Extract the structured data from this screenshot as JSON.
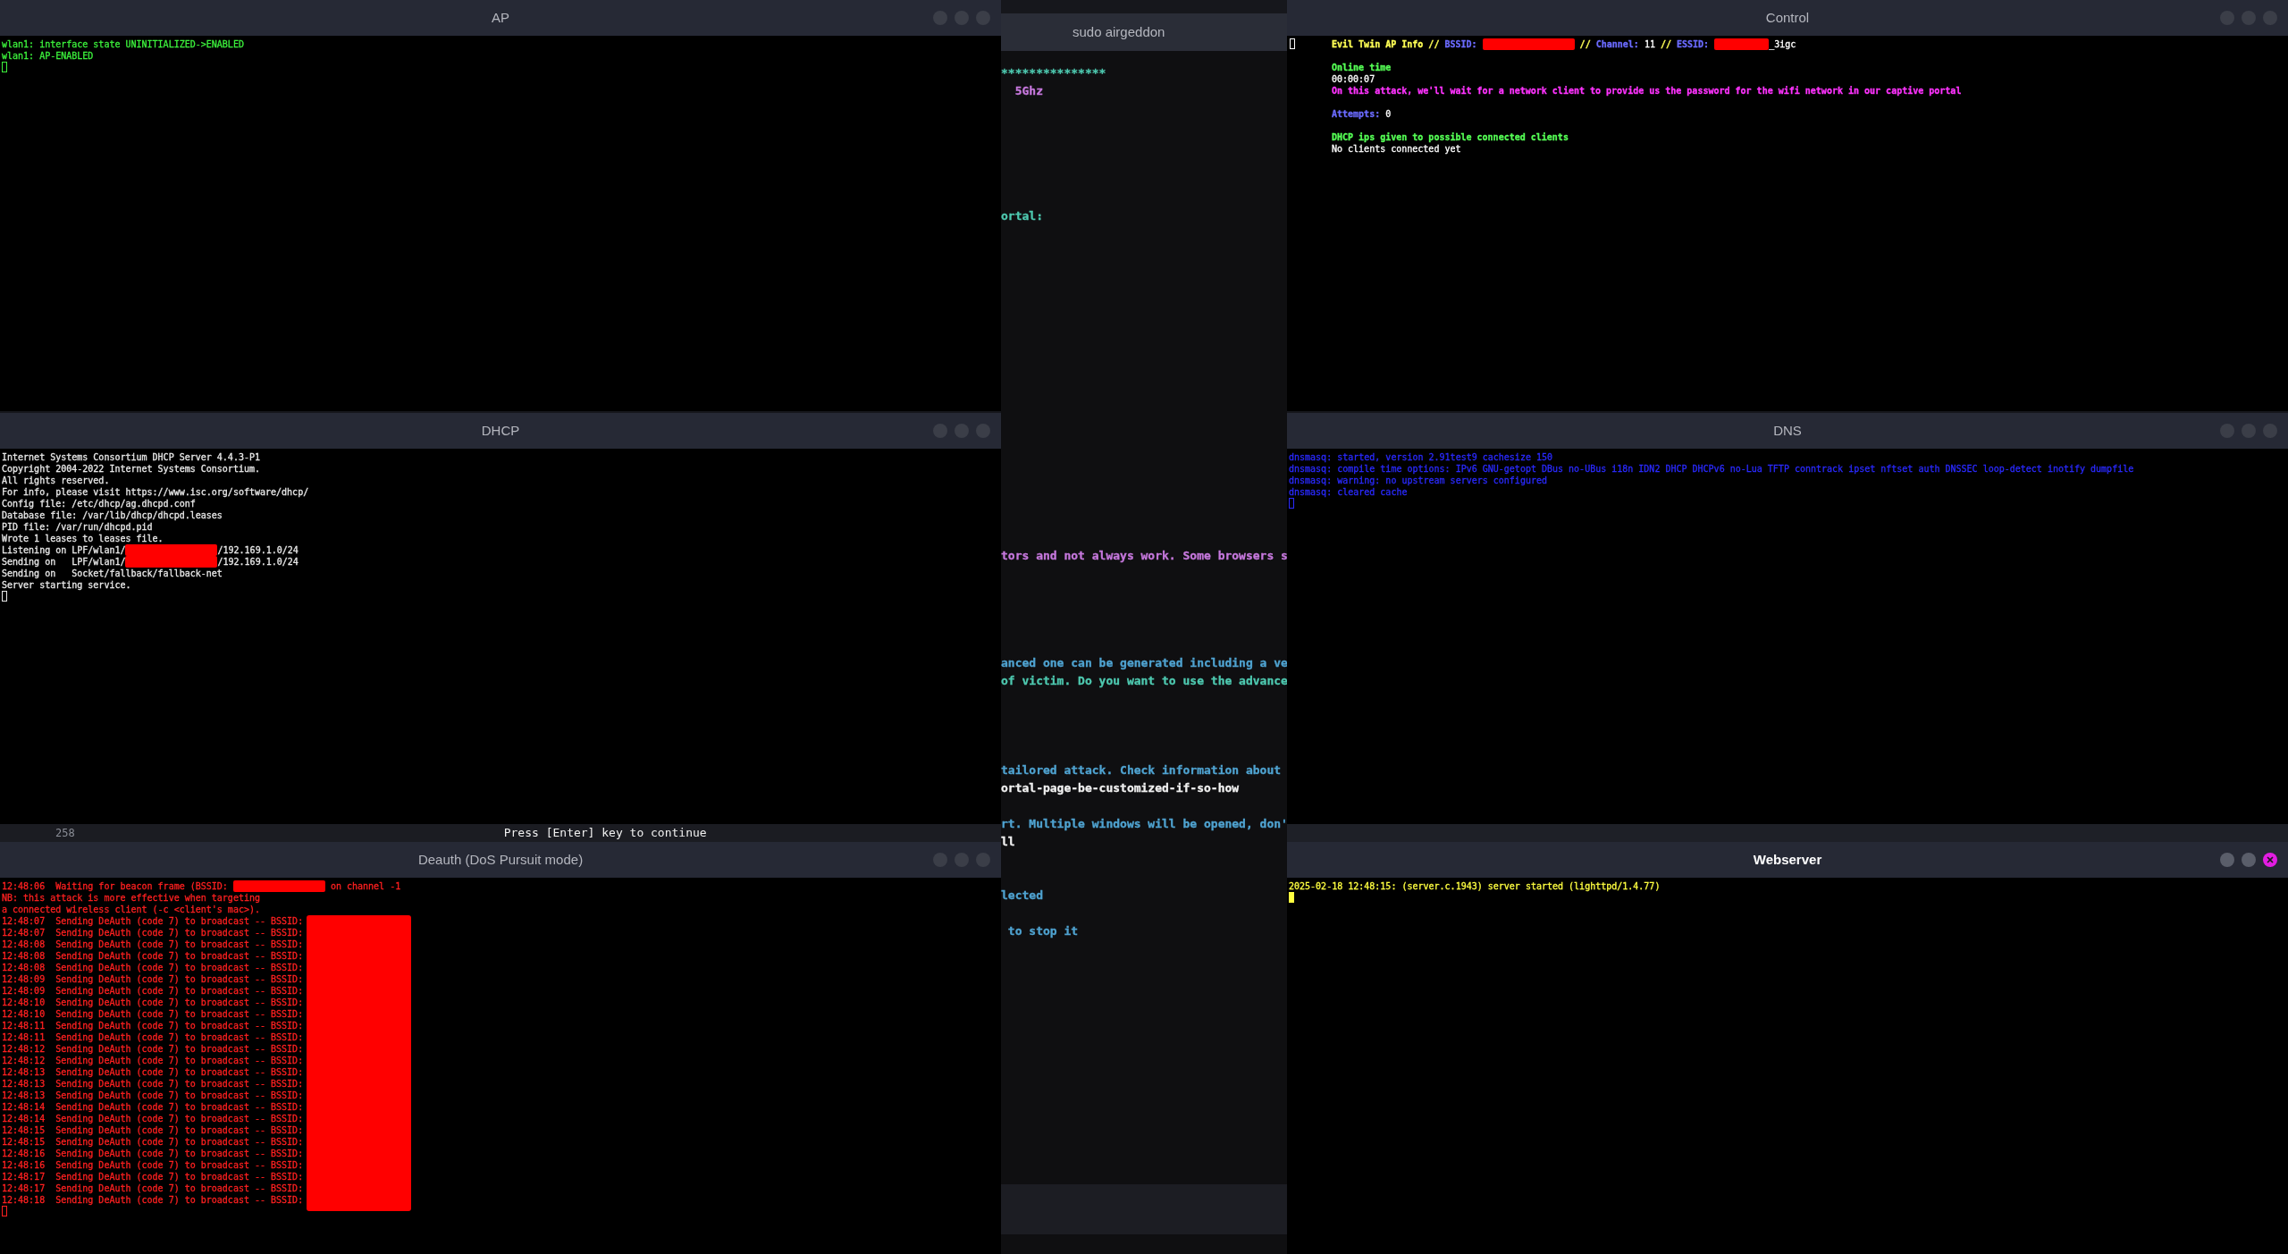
{
  "background_window": {
    "line_number": "258",
    "text": "Press [Enter] key to continue"
  },
  "windows": [
    {
      "title": "AP",
      "kind": "xterm",
      "focused": false,
      "cursor": true,
      "lines": [
        {
          "kind": "text",
          "segments": [
            {
              "kind": "text",
              "text": "wlan1: interface state UNINITIALIZED->ENABLED",
              "color": "#3cf03c"
            }
          ]
        },
        {
          "kind": "text",
          "segments": [
            {
              "kind": "text",
              "text": "wlan1: AP-ENABLED",
              "color": "#3cf03c"
            }
          ]
        }
      ]
    },
    {
      "title": "sudo airgeddon",
      "kind": "console",
      "focused": false,
      "lines": [
        {
          "kind": "text",
          "segments": [
            {
              "kind": "text",
              "text": "***************",
              "color": "#4ec9b0"
            }
          ]
        },
        {
          "kind": "text",
          "segments": [
            {
              "kind": "text",
              "text": "  5Ghz",
              "color": "#c678dd"
            }
          ]
        },
        {
          "kind": "blank"
        },
        {
          "kind": "blank"
        },
        {
          "kind": "blank"
        },
        {
          "kind": "blank"
        },
        {
          "kind": "blank"
        },
        {
          "kind": "blank"
        },
        {
          "kind": "text",
          "segments": [
            {
              "kind": "text",
              "text": "ortal:",
              "color": "#4ec9b0"
            }
          ]
        },
        {
          "kind": "blank"
        },
        {
          "kind": "blank"
        },
        {
          "kind": "blank"
        },
        {
          "kind": "blank"
        },
        {
          "kind": "blank"
        },
        {
          "kind": "blank"
        },
        {
          "kind": "blank"
        },
        {
          "kind": "blank"
        },
        {
          "kind": "blank"
        },
        {
          "kind": "blank"
        },
        {
          "kind": "blank"
        },
        {
          "kind": "blank"
        },
        {
          "kind": "blank"
        },
        {
          "kind": "blank"
        },
        {
          "kind": "blank"
        },
        {
          "kind": "blank"
        },
        {
          "kind": "blank"
        },
        {
          "kind": "blank"
        },
        {
          "kind": "text",
          "segments": [
            {
              "kind": "text",
              "text": "tors and not always work. Some browsers s",
              "color": "#c678dd"
            }
          ]
        },
        {
          "kind": "blank"
        },
        {
          "kind": "blank"
        },
        {
          "kind": "blank"
        },
        {
          "kind": "blank"
        },
        {
          "kind": "blank"
        },
        {
          "kind": "text",
          "segments": [
            {
              "kind": "text",
              "text": "anced one can be generated including a ve",
              "color": "#4fa3d1"
            }
          ]
        },
        {
          "kind": "text",
          "segments": [
            {
              "kind": "text",
              "text": "of victim. Do you want to use the advance",
              "color": "#4ec9b0"
            }
          ]
        },
        {
          "kind": "blank"
        },
        {
          "kind": "blank"
        },
        {
          "kind": "blank"
        },
        {
          "kind": "blank"
        },
        {
          "kind": "text",
          "segments": [
            {
              "kind": "text",
              "text": "tailored attack. Check information about",
              "color": "#4fa3d1"
            }
          ]
        },
        {
          "kind": "text",
          "segments": [
            {
              "kind": "text",
              "text": "ortal-page-be-customized-if-so-how",
              "color": "#f0f0f0"
            }
          ]
        },
        {
          "kind": "blank"
        },
        {
          "kind": "text",
          "segments": [
            {
              "kind": "text",
              "text": "rt. Multiple windows will be opened, don'",
              "color": "#4fa3d1"
            }
          ]
        },
        {
          "kind": "text",
          "segments": [
            {
              "kind": "text",
              "text": "ll",
              "color": "#f0f0f0"
            }
          ]
        },
        {
          "kind": "blank"
        },
        {
          "kind": "blank"
        },
        {
          "kind": "text",
          "segments": [
            {
              "kind": "text",
              "text": "lected",
              "color": "#4fa3d1"
            }
          ]
        },
        {
          "kind": "blank"
        },
        {
          "kind": "text",
          "segments": [
            {
              "kind": "text",
              "text": " to stop it",
              "color": "#4fa3d1"
            }
          ]
        }
      ]
    },
    {
      "title": "Control",
      "kind": "xterm",
      "focused": false,
      "cursor": true,
      "lines": [
        {
          "kind": "text",
          "segments": [
            {
              "kind": "text",
              "text": "Evil Twin AP Info // ",
              "color": "#ffff55",
              "bold": true
            },
            {
              "kind": "text",
              "text": "BSSID: ",
              "color": "#6b6bff",
              "bold": true
            },
            {
              "kind": "redacted"
            },
            {
              "kind": "text",
              "text": " // ",
              "color": "#ffff55",
              "bold": true
            },
            {
              "kind": "text",
              "text": "Channel: ",
              "color": "#6b6bff",
              "bold": true
            },
            {
              "kind": "text",
              "text": "11 ",
              "color": "#ffffff"
            },
            {
              "kind": "text",
              "text": "// ",
              "color": "#ffff55",
              "bold": true
            },
            {
              "kind": "text",
              "text": "ESSID: ",
              "color": "#6b6bff",
              "bold": true
            },
            {
              "kind": "short_redacted"
            },
            {
              "kind": "text",
              "text": "_3igc",
              "color": "#ffffff"
            }
          ]
        },
        {
          "kind": "blank"
        },
        {
          "kind": "text",
          "segments": [
            {
              "kind": "text",
              "text": "Online time",
              "color": "#55ff55",
              "bold": true
            }
          ]
        },
        {
          "kind": "text",
          "segments": [
            {
              "kind": "text",
              "text": "00:00:07",
              "color": "#ffffff"
            }
          ]
        },
        {
          "kind": "text",
          "segments": [
            {
              "kind": "text",
              "text": "On this attack, we'll wait for a network client to provide us the password for the wifi network in our captive portal",
              "color": "#ff33ff",
              "bold": true
            }
          ]
        },
        {
          "kind": "blank"
        },
        {
          "kind": "text",
          "segments": [
            {
              "kind": "text",
              "text": "Attempts: ",
              "color": "#6b6bff",
              "bold": true
            },
            {
              "kind": "text",
              "text": "0",
              "color": "#ffffff"
            }
          ]
        },
        {
          "kind": "blank"
        },
        {
          "kind": "text",
          "segments": [
            {
              "kind": "text",
              "text": "DHCP ips given to possible connected clients",
              "color": "#55ff55",
              "bold": true
            }
          ]
        },
        {
          "kind": "text",
          "segments": [
            {
              "kind": "text",
              "text": "No clients connected yet",
              "color": "#ffffff"
            }
          ]
        }
      ]
    },
    {
      "title": "DHCP",
      "kind": "xterm",
      "focused": false,
      "cursor": true,
      "lines": [
        {
          "kind": "text",
          "segments": [
            {
              "kind": "text",
              "text": "Internet Systems Consortium DHCP Server 4.4.3-P1",
              "color": "#e8e8e8"
            }
          ]
        },
        {
          "kind": "text",
          "segments": [
            {
              "kind": "text",
              "text": "Copyright 2004-2022 Internet Systems Consortium.",
              "color": "#e8e8e8"
            }
          ]
        },
        {
          "kind": "text",
          "segments": [
            {
              "kind": "text",
              "text": "All rights reserved.",
              "color": "#e8e8e8"
            }
          ]
        },
        {
          "kind": "text",
          "segments": [
            {
              "kind": "text",
              "text": "For info, please visit https://www.isc.org/software/dhcp/",
              "color": "#e8e8e8"
            }
          ]
        },
        {
          "kind": "text",
          "segments": [
            {
              "kind": "text",
              "text": "Config file: /etc/dhcp/ag.dhcpd.conf",
              "color": "#e8e8e8"
            }
          ]
        },
        {
          "kind": "text",
          "segments": [
            {
              "kind": "text",
              "text": "Database file: /var/lib/dhcp/dhcpd.leases",
              "color": "#e8e8e8"
            }
          ]
        },
        {
          "kind": "text",
          "segments": [
            {
              "kind": "text",
              "text": "PID file: /var/run/dhcpd.pid",
              "color": "#e8e8e8"
            }
          ]
        },
        {
          "kind": "text",
          "segments": [
            {
              "kind": "text",
              "text": "Wrote 1 leases to leases file.",
              "color": "#e8e8e8"
            }
          ]
        },
        {
          "kind": "text",
          "segments": [
            {
              "kind": "text",
              "text": "Listening on LPF/wlan1/",
              "color": "#e8e8e8"
            },
            {
              "kind": "redacted"
            },
            {
              "kind": "text",
              "text": "/192.169.1.0/24",
              "color": "#e8e8e8"
            }
          ]
        },
        {
          "kind": "text",
          "segments": [
            {
              "kind": "text",
              "text": "Sending on   LPF/wlan1/",
              "color": "#e8e8e8"
            },
            {
              "kind": "redacted"
            },
            {
              "kind": "text",
              "text": "/192.169.1.0/24",
              "color": "#e8e8e8"
            }
          ]
        },
        {
          "kind": "text",
          "segments": [
            {
              "kind": "text",
              "text": "Sending on   Socket/fallback/fallback-net",
              "color": "#e8e8e8"
            }
          ]
        },
        {
          "kind": "text",
          "segments": [
            {
              "kind": "text",
              "text": "Server starting service.",
              "color": "#e8e8e8"
            }
          ]
        }
      ]
    },
    {
      "title": "DNS",
      "kind": "xterm",
      "focused": false,
      "cursor": true,
      "lines": [
        {
          "kind": "text",
          "segments": [
            {
              "kind": "text",
              "text": "dnsmasq: started, version 2.91test9 cachesize 150",
              "color": "#2a2aff"
            }
          ]
        },
        {
          "kind": "text",
          "segments": [
            {
              "kind": "text",
              "text": "dnsmasq: compile time options: IPv6 GNU-getopt DBus no-UBus i18n IDN2 DHCP DHCPv6 no-Lua TFTP conntrack ipset nftset auth DNSSEC loop-detect inotify dumpfile",
              "color": "#2a2aff"
            }
          ]
        },
        {
          "kind": "text",
          "segments": [
            {
              "kind": "text",
              "text": "dnsmasq: warning: no upstream servers configured",
              "color": "#2a2aff"
            }
          ]
        },
        {
          "kind": "text",
          "segments": [
            {
              "kind": "text",
              "text": "dnsmasq: cleared cache",
              "color": "#2a2aff"
            }
          ]
        }
      ]
    },
    {
      "title": "Deauth (DoS Pursuit mode)",
      "kind": "xterm",
      "focused": false,
      "cursor": true,
      "side_redaction": true,
      "lines": [
        {
          "kind": "text",
          "segments": [
            {
              "kind": "text",
              "text": "12:48:06  Waiting for beacon frame (BSSID: ",
              "color": "#ff2020"
            },
            {
              "kind": "redacted"
            },
            {
              "kind": "text",
              "text": " on channel -1",
              "color": "#ff2020"
            }
          ]
        },
        {
          "kind": "text",
          "segments": [
            {
              "kind": "text",
              "text": "NB: this attack is more effective when targeting",
              "color": "#ff2020"
            }
          ]
        },
        {
          "kind": "text",
          "segments": [
            {
              "kind": "text",
              "text": "a connected wireless client (-c <client's mac>).",
              "color": "#ff2020"
            }
          ]
        },
        {
          "kind": "text",
          "segments": [
            {
              "kind": "text",
              "text": "12:48:07  Sending DeAuth (code 7) to broadcast -- BSSID:",
              "color": "#ff2020"
            }
          ]
        },
        {
          "kind": "text",
          "segments": [
            {
              "kind": "text",
              "text": "12:48:07  Sending DeAuth (code 7) to broadcast -- BSSID:",
              "color": "#ff2020"
            }
          ]
        },
        {
          "kind": "text",
          "segments": [
            {
              "kind": "text",
              "text": "12:48:08  Sending DeAuth (code 7) to broadcast -- BSSID:",
              "color": "#ff2020"
            }
          ]
        },
        {
          "kind": "text",
          "segments": [
            {
              "kind": "text",
              "text": "12:48:08  Sending DeAuth (code 7) to broadcast -- BSSID:",
              "color": "#ff2020"
            }
          ]
        },
        {
          "kind": "text",
          "segments": [
            {
              "kind": "text",
              "text": "12:48:08  Sending DeAuth (code 7) to broadcast -- BSSID:",
              "color": "#ff2020"
            }
          ]
        },
        {
          "kind": "text",
          "segments": [
            {
              "kind": "text",
              "text": "12:48:09  Sending DeAuth (code 7) to broadcast -- BSSID:",
              "color": "#ff2020"
            }
          ]
        },
        {
          "kind": "text",
          "segments": [
            {
              "kind": "text",
              "text": "12:48:09  Sending DeAuth (code 7) to broadcast -- BSSID:",
              "color": "#ff2020"
            }
          ]
        },
        {
          "kind": "text",
          "segments": [
            {
              "kind": "text",
              "text": "12:48:10  Sending DeAuth (code 7) to broadcast -- BSSID:",
              "color": "#ff2020"
            }
          ]
        },
        {
          "kind": "text",
          "segments": [
            {
              "kind": "text",
              "text": "12:48:10  Sending DeAuth (code 7) to broadcast -- BSSID:",
              "color": "#ff2020"
            }
          ]
        },
        {
          "kind": "text",
          "segments": [
            {
              "kind": "text",
              "text": "12:48:11  Sending DeAuth (code 7) to broadcast -- BSSID:",
              "color": "#ff2020"
            }
          ]
        },
        {
          "kind": "text",
          "segments": [
            {
              "kind": "text",
              "text": "12:48:11  Sending DeAuth (code 7) to broadcast -- BSSID:",
              "color": "#ff2020"
            }
          ]
        },
        {
          "kind": "text",
          "segments": [
            {
              "kind": "text",
              "text": "12:48:12  Sending DeAuth (code 7) to broadcast -- BSSID:",
              "color": "#ff2020"
            }
          ]
        },
        {
          "kind": "text",
          "segments": [
            {
              "kind": "text",
              "text": "12:48:12  Sending DeAuth (code 7) to broadcast -- BSSID:",
              "color": "#ff2020"
            }
          ]
        },
        {
          "kind": "text",
          "segments": [
            {
              "kind": "text",
              "text": "12:48:13  Sending DeAuth (code 7) to broadcast -- BSSID:",
              "color": "#ff2020"
            }
          ]
        },
        {
          "kind": "text",
          "segments": [
            {
              "kind": "text",
              "text": "12:48:13  Sending DeAuth (code 7) to broadcast -- BSSID:",
              "color": "#ff2020"
            }
          ]
        },
        {
          "kind": "text",
          "segments": [
            {
              "kind": "text",
              "text": "12:48:13  Sending DeAuth (code 7) to broadcast -- BSSID:",
              "color": "#ff2020"
            }
          ]
        },
        {
          "kind": "text",
          "segments": [
            {
              "kind": "text",
              "text": "12:48:14  Sending DeAuth (code 7) to broadcast -- BSSID:",
              "color": "#ff2020"
            }
          ]
        },
        {
          "kind": "text",
          "segments": [
            {
              "kind": "text",
              "text": "12:48:14  Sending DeAuth (code 7) to broadcast -- BSSID:",
              "color": "#ff2020"
            }
          ]
        },
        {
          "kind": "text",
          "segments": [
            {
              "kind": "text",
              "text": "12:48:15  Sending DeAuth (code 7) to broadcast -- BSSID:",
              "color": "#ff2020"
            }
          ]
        },
        {
          "kind": "text",
          "segments": [
            {
              "kind": "text",
              "text": "12:48:15  Sending DeAuth (code 7) to broadcast -- BSSID:",
              "color": "#ff2020"
            }
          ]
        },
        {
          "kind": "text",
          "segments": [
            {
              "kind": "text",
              "text": "12:48:16  Sending DeAuth (code 7) to broadcast -- BSSID:",
              "color": "#ff2020"
            }
          ]
        },
        {
          "kind": "text",
          "segments": [
            {
              "kind": "text",
              "text": "12:48:16  Sending DeAuth (code 7) to broadcast -- BSSID:",
              "color": "#ff2020"
            }
          ]
        },
        {
          "kind": "text",
          "segments": [
            {
              "kind": "text",
              "text": "12:48:17  Sending DeAuth (code 7) to broadcast -- BSSID:",
              "color": "#ff2020"
            }
          ]
        },
        {
          "kind": "text",
          "segments": [
            {
              "kind": "text",
              "text": "12:48:17  Sending DeAuth (code 7) to broadcast -- BSSID:",
              "color": "#ff2020"
            }
          ]
        },
        {
          "kind": "text",
          "segments": [
            {
              "kind": "text",
              "text": "12:48:18  Sending DeAuth (code 7) to broadcast -- BSSID:",
              "color": "#ff2020"
            }
          ]
        }
      ]
    },
    {
      "title": "Webserver",
      "kind": "xterm",
      "focused": true,
      "cursor": true,
      "lines": [
        {
          "kind": "text",
          "segments": [
            {
              "kind": "text",
              "text": "2025-02-18 12:48:15: (server.c.1943) server started (lighttpd/1.4.77)",
              "color": "#ffff40"
            }
          ]
        }
      ]
    }
  ]
}
